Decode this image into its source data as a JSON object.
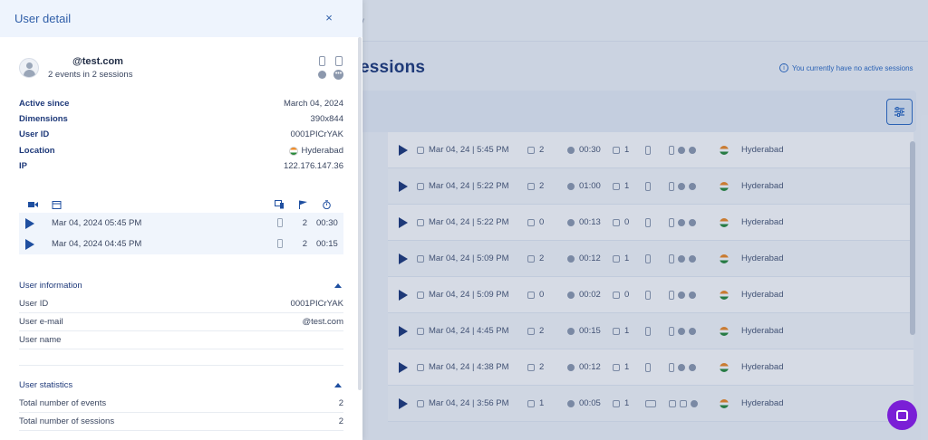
{
  "background": {
    "page_title": "essions",
    "crumb": "y",
    "notice": "You currently have no active sessions",
    "rows": [
      {
        "date": "Mar 04, 24 | 5:45 PM",
        "events": "2",
        "duration": "00:30",
        "pages": "1",
        "location": "Hyderabad",
        "platform": "mobile"
      },
      {
        "date": "Mar 04, 24 | 5:22 PM",
        "events": "2",
        "duration": "01:00",
        "pages": "1",
        "location": "Hyderabad",
        "platform": "mobile"
      },
      {
        "date": "Mar 04, 24 | 5:22 PM",
        "events": "0",
        "duration": "00:13",
        "pages": "0",
        "location": "Hyderabad",
        "platform": "mobile"
      },
      {
        "date": "Mar 04, 24 | 5:09 PM",
        "events": "2",
        "duration": "00:12",
        "pages": "1",
        "location": "Hyderabad",
        "platform": "mobile"
      },
      {
        "date": "Mar 04, 24 | 5:09 PM",
        "events": "0",
        "duration": "00:02",
        "pages": "0",
        "location": "Hyderabad",
        "platform": "mobile"
      },
      {
        "date": "Mar 04, 24 | 4:45 PM",
        "events": "2",
        "duration": "00:15",
        "pages": "1",
        "location": "Hyderabad",
        "platform": "mobile"
      },
      {
        "date": "Mar 04, 24 | 4:38 PM",
        "events": "2",
        "duration": "00:12",
        "pages": "1",
        "location": "Hyderabad",
        "platform": "mobile"
      },
      {
        "date": "Mar 04, 24 | 3:56 PM",
        "events": "1",
        "duration": "00:05",
        "pages": "1",
        "location": "Hyderabad",
        "platform": "desktop"
      }
    ]
  },
  "panel": {
    "title": "User detail",
    "close_label": "×",
    "user": {
      "email": "@test.com",
      "summary": "2 events in 2 sessions"
    },
    "details": [
      {
        "label": "Active since",
        "value": "March 04, 2024"
      },
      {
        "label": "Dimensions",
        "value": "390x844"
      },
      {
        "label": "User ID",
        "value": "0001PICrYAK"
      },
      {
        "label": "Location",
        "value": "Hyderabad"
      },
      {
        "label": "IP",
        "value": "122.176.147.36"
      }
    ],
    "sessions": [
      {
        "date": "Mar 04, 2024  05:45 PM",
        "events": "2",
        "duration": "00:30"
      },
      {
        "date": "Mar 04, 2024  04:45 PM",
        "events": "2",
        "duration": "00:15"
      }
    ],
    "user_information": {
      "heading": "User information",
      "rows": [
        {
          "label": "User ID",
          "value": "0001PICrYAK"
        },
        {
          "label": "User e-mail",
          "value": "@test.com"
        },
        {
          "label": "User name",
          "value": ""
        }
      ]
    },
    "user_statistics": {
      "heading": "User statistics",
      "rows": [
        {
          "label": "Total number of events",
          "value": "2"
        },
        {
          "label": "Total number of sessions",
          "value": "2"
        }
      ]
    }
  },
  "colors": {
    "accent": "#1f4fa0",
    "chat_button": "#7a1fd6",
    "header_bg": "#eef4fd"
  }
}
